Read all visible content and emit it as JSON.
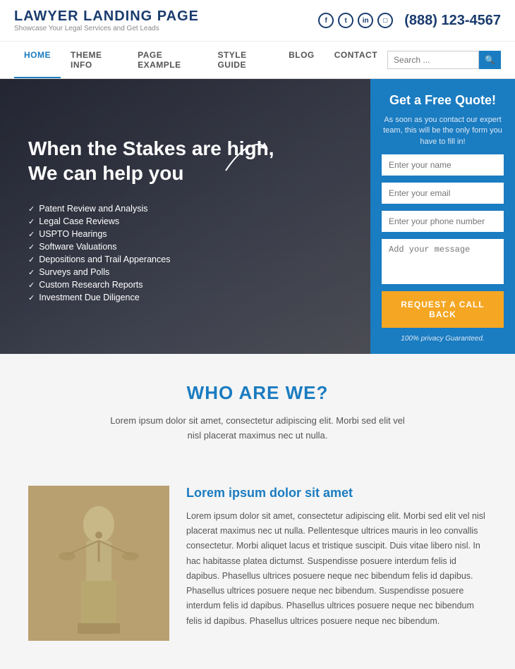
{
  "header": {
    "logo_title": "LAWYER LANDING PAGE",
    "logo_sub": "Showcase Your Legal Services and Get Leads",
    "social": [
      "f",
      "t",
      "in",
      "ig"
    ],
    "phone": "(888) 123-4567"
  },
  "nav": {
    "links": [
      {
        "label": "HOME",
        "active": true
      },
      {
        "label": "THEME INFO",
        "active": false
      },
      {
        "label": "PAGE EXAMPLE",
        "active": false
      },
      {
        "label": "STYLE GUIDE",
        "active": false
      },
      {
        "label": "BLOG",
        "active": false
      },
      {
        "label": "CONTACT",
        "active": false
      }
    ],
    "search_placeholder": "Search ..."
  },
  "hero": {
    "title": "When the Stakes are high,\nWe can help you",
    "checklist": [
      "Patent Review and Analysis",
      "Legal Case Reviews",
      "USPTO Hearings",
      "Software Valuations",
      "Depositions and Trail Apperances",
      "Surveys and Polls",
      "Custom Research Reports",
      "Investment Due Diligence"
    ]
  },
  "quote_form": {
    "title": "Get a Free Quote!",
    "subtitle": "As soon as you contact our expert team, this will be the only form you have to fill in!",
    "name_placeholder": "Enter your name",
    "email_placeholder": "Enter your email",
    "phone_placeholder": "Enter your phone number",
    "message_placeholder": "Add your message",
    "button_label": "REQUEST A CALL BACK",
    "privacy_text": "100% privacy Guaranteed."
  },
  "who_section": {
    "title": "WHO ARE WE?",
    "desc": "Lorem ipsum dolor sit amet, consectetur adipiscing elit. Morbi sed elit vel nisl placerat maximus nec ut nulla."
  },
  "content_section": {
    "heading": "Lorem ipsum dolor sit amet",
    "body": "Lorem ipsum dolor sit amet, consectetur adipiscing elit. Morbi sed elit vel nisl placerat maximus nec ut nulla. Pellentesque ultrices mauris in leo convallis consectetur. Morbi aliquet lacus et tristique suscipit. Duis vitae libero nisl. In hac habitasse platea dictumst. Suspendisse posuere interdum felis id dapibus. Phasellus ultrices posuere neque nec bibendum felis id dapibus. Phasellus ultrices posuere neque nec bibendum. Suspendisse posuere interdum felis id dapibus. Phasellus ultrices posuere neque nec bibendum felis id dapibus. Phasellus ultrices posuere neque nec bibendum."
  }
}
